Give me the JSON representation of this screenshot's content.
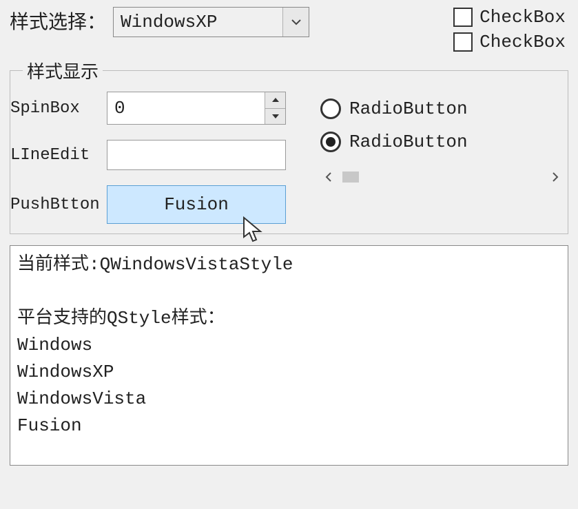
{
  "header": {
    "style_label": "样式选择：",
    "style_value": "WindowsXP"
  },
  "checkboxes": [
    {
      "label": "CheckBox",
      "checked": false
    },
    {
      "label": "CheckBox",
      "checked": false
    }
  ],
  "group": {
    "title": "样式显示",
    "spinbox_label": "SpinBox",
    "spinbox_value": "0",
    "lineedit_label": "LIneEdit",
    "lineedit_value": "",
    "pushbutton_label": "PushBtton",
    "pushbutton_text": "Fusion",
    "radios": [
      {
        "label": "RadioButton",
        "checked": false
      },
      {
        "label": "RadioButton",
        "checked": true
      }
    ]
  },
  "output": {
    "text": "当前样式:QWindowsVistaStyle\n\n平台支持的QStyle样式：\nWindows\nWindowsXP\nWindowsVista\nFusion"
  }
}
